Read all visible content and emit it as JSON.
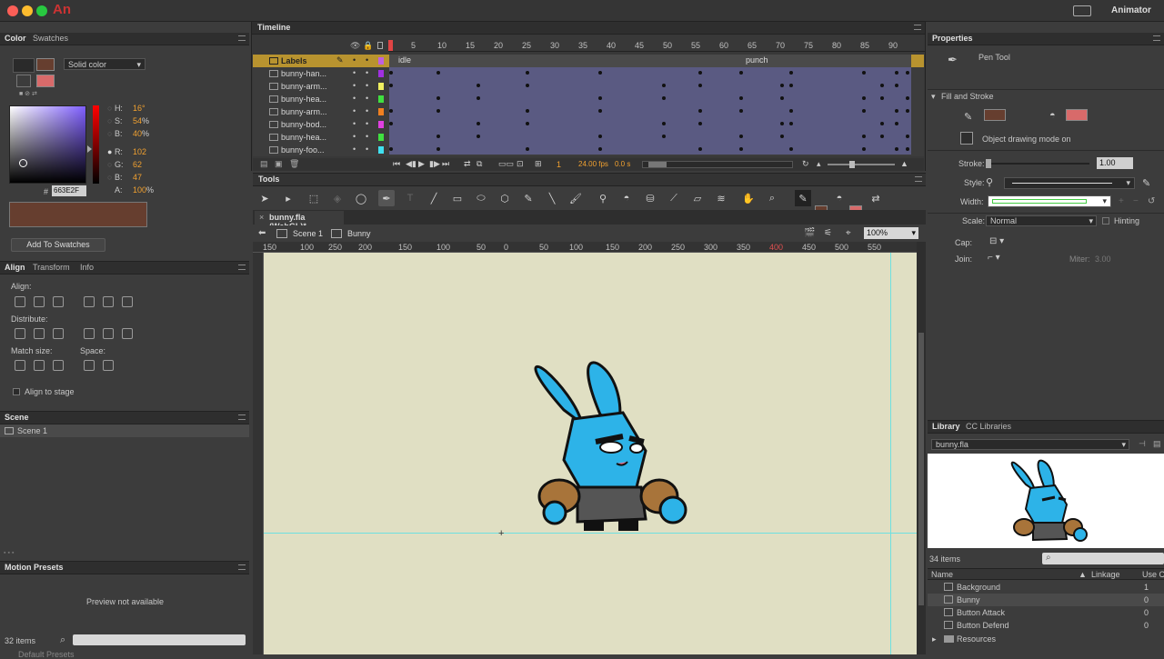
{
  "app": {
    "logo": "An",
    "workspace": "Animator"
  },
  "color_panel": {
    "tabs": [
      "Color",
      "Swatches"
    ],
    "fill_type": "Solid color",
    "h": "16",
    "h_unit": "°",
    "s": "54",
    "s_unit": "%",
    "b": "40",
    "b_unit": "%",
    "r": "102",
    "g": "62",
    "bl": "47",
    "a": "100",
    "a_unit": "%",
    "hex": "663E2F",
    "add_button": "Add To Swatches",
    "labels": {
      "h": "H:",
      "s": "S:",
      "b": "B:",
      "r": "R:",
      "g": "G:",
      "bl": "B:",
      "a": "A:",
      "hash": "#"
    }
  },
  "align_panel": {
    "tabs": [
      "Align",
      "Transform",
      "Info"
    ],
    "align": "Align:",
    "distribute": "Distribute:",
    "match": "Match size:",
    "space": "Space:",
    "stage": "Align to stage"
  },
  "scene_panel": {
    "title": "Scene",
    "item": "Scene 1"
  },
  "motion_panel": {
    "title": "Motion Presets",
    "preview": "Preview not available",
    "count": "32 items",
    "folder": "Default Presets"
  },
  "timeline": {
    "title": "Timeline",
    "frames": [
      "5",
      "10",
      "15",
      "20",
      "25",
      "30",
      "35",
      "40",
      "45",
      "50",
      "55",
      "60",
      "65",
      "70",
      "75",
      "80",
      "85",
      "90"
    ],
    "layers": [
      {
        "name": "Labels",
        "color": "#c060e0"
      },
      {
        "name": "bunny-han...",
        "color": "#a030e0"
      },
      {
        "name": "bunny-arm...",
        "color": "#f0f060"
      },
      {
        "name": "bunny-hea...",
        "color": "#40e040"
      },
      {
        "name": "bunny-arm...",
        "color": "#f08020"
      },
      {
        "name": "bunny-bod...",
        "color": "#e040e0"
      },
      {
        "name": "bunny-hea...",
        "color": "#40e040"
      },
      {
        "name": "bunny-foo...",
        "color": "#40e0f0"
      }
    ],
    "label_idle": "idle",
    "label_punch": "punch",
    "current_frame": "1",
    "fps": "24.00 fps",
    "time": "0.0 s"
  },
  "tools": {
    "title": "Tools"
  },
  "stage": {
    "doc_tab": "bunny.fla (WebGL)*",
    "scene": "Scene 1",
    "symbol": "Bunny",
    "zoom": "100%",
    "ruler": [
      "150",
      "100",
      "250",
      "200",
      "150",
      "100",
      "50",
      "0",
      "50",
      "100",
      "150",
      "200",
      "250",
      "300",
      "350",
      "400",
      "450",
      "500",
      "550"
    ]
  },
  "properties": {
    "title": "Properties",
    "tool": "Pen Tool",
    "section": "Fill and Stroke",
    "drawing_mode": "Object drawing mode on",
    "stroke_label": "Stroke:",
    "stroke": "1.00",
    "style_label": "Style:",
    "width_label": "Width:",
    "scale_label": "Scale:",
    "scale": "Normal",
    "hinting": "Hinting",
    "cap_label": "Cap:",
    "join_label": "Join:",
    "miter_label": "Miter:",
    "miter": "3.00"
  },
  "library": {
    "tabs": [
      "Library",
      "CC Libraries"
    ],
    "file": "bunny.fla",
    "count": "34 items",
    "col_name": "Name",
    "col_linkage": "Linkage",
    "col_use": "Use C",
    "items": [
      {
        "name": "Background",
        "use": "1"
      },
      {
        "name": "Bunny",
        "use": "0"
      },
      {
        "name": "Button Attack",
        "use": "0"
      },
      {
        "name": "Button Defend",
        "use": "0"
      },
      {
        "name": "Resources",
        "use": ""
      }
    ]
  },
  "colors": {
    "fill": "#663E2F",
    "stroke": "#d86a6a",
    "stage": "#e0dfc3",
    "accent": "#f0a030"
  }
}
